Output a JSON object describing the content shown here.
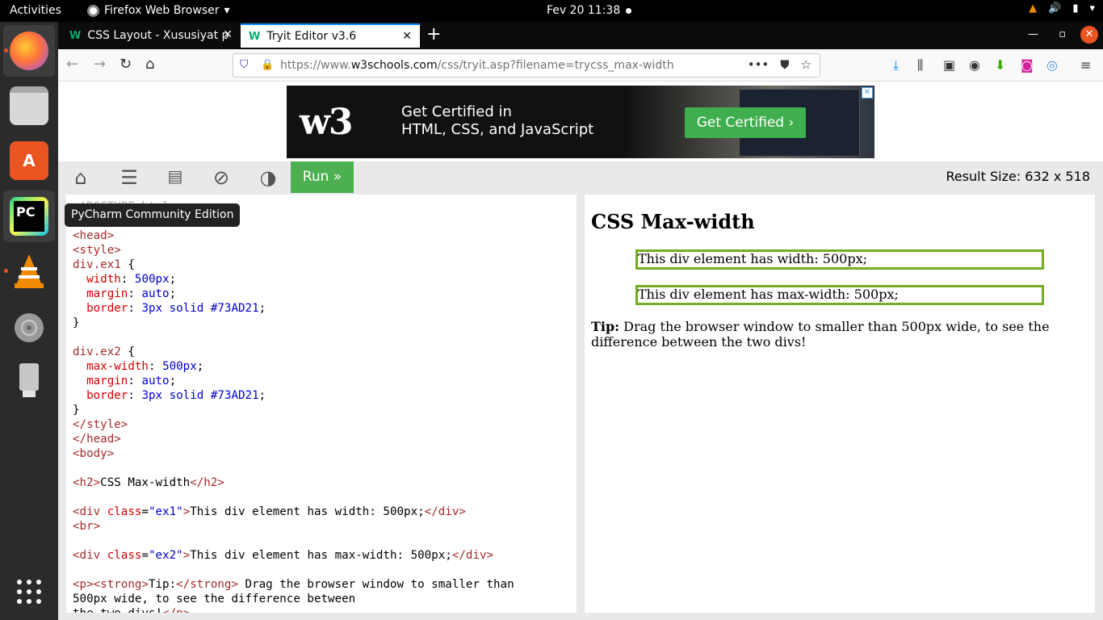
{
  "topbar": {
    "activities": "Activities",
    "app_name": "Firefox Web Browser",
    "clock": "Fev 20  11:38"
  },
  "dock": {
    "tooltip": "PyCharm Community Edition",
    "items": [
      "firefox-icon",
      "files-icon",
      "software-center-icon",
      "pycharm-icon",
      "vlc-icon",
      "disc-icon",
      "usb-drive-icon",
      "app-grid-icon"
    ]
  },
  "browser": {
    "tabs": [
      {
        "title": "CSS Layout - Xususiyat p",
        "active": false
      },
      {
        "title": "Tryit Editor v3.6",
        "active": true
      }
    ],
    "url_prefix": "https://www.",
    "url_domain": "w3schools.com",
    "url_path": "/css/tryit.asp?filename=trycss_max-width"
  },
  "ad": {
    "logo": "w3",
    "line1": "Get Certified in",
    "line2": "HTML, CSS, and JavaScript",
    "cta": "Get Certified ›"
  },
  "tryit": {
    "run_label": "Run »",
    "result_size_label": "Result Size: 632  x  518"
  },
  "result": {
    "heading": "CSS Max-width",
    "box1": "This div element has width: 500px;",
    "box2": "This div element has max-width: 500px;",
    "tip_strong": "Tip:",
    "tip_text": " Drag the browser window to smaller than 500px wide, to see the difference between the two divs!"
  },
  "colors": {
    "border_green": "#73AD21",
    "run_green": "#4caf50",
    "ubuntu_orange": "#e95420"
  }
}
